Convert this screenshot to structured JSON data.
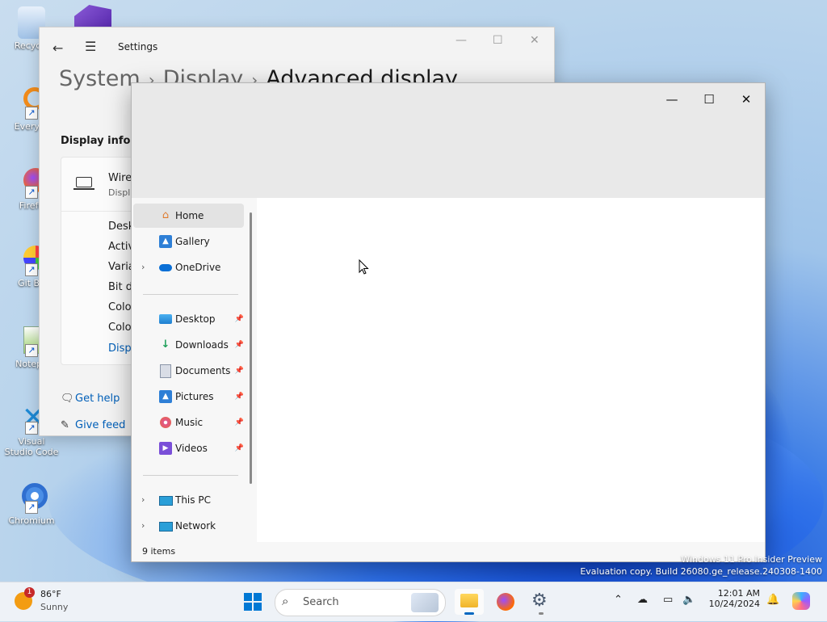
{
  "desktop": {
    "icons": [
      {
        "label": "Recycle",
        "icon": "recycle-bin-icon"
      },
      {
        "label": "Everyth",
        "icon": "everything-icon"
      },
      {
        "label": "Firefo",
        "icon": "firefox-icon"
      },
      {
        "label": "Git Ba",
        "icon": "git-bash-icon"
      },
      {
        "label": "Notepa",
        "icon": "notepad-icon"
      },
      {
        "label": "Visual Studio Code",
        "icon": "vscode-icon"
      },
      {
        "label": "Chromium",
        "icon": "chromium-icon"
      }
    ],
    "watermark": {
      "line1": "Windows 11 Pro Insider Preview",
      "line2": "Evaluation copy. Build 26080.ge_release.240308-1400"
    }
  },
  "settings": {
    "app_title": "Settings",
    "breadcrumb": [
      "System",
      "Display",
      "Advanced display"
    ],
    "section_title": "Display inform",
    "display_name": "Wire",
    "display_sub": "Displ",
    "rows": [
      "Desk",
      "Activ",
      "Varia",
      "Bit d",
      "Colo",
      "Colo"
    ],
    "link": "Disp",
    "help": [
      "Get help",
      "Give feed"
    ]
  },
  "explorer": {
    "nav": [
      {
        "label": "Home",
        "icon": "home-icon",
        "selected": true,
        "chevron": false
      },
      {
        "label": "Gallery",
        "icon": "gallery-icon",
        "selected": false,
        "chevron": false
      },
      {
        "label": "OneDrive",
        "icon": "onedrive-icon",
        "selected": false,
        "chevron": true
      }
    ],
    "quick_access": [
      {
        "label": "Desktop",
        "icon": "desktop-folder-icon"
      },
      {
        "label": "Downloads",
        "icon": "downloads-icon"
      },
      {
        "label": "Documents",
        "icon": "documents-icon"
      },
      {
        "label": "Pictures",
        "icon": "pictures-icon"
      },
      {
        "label": "Music",
        "icon": "music-icon"
      },
      {
        "label": "Videos",
        "icon": "videos-icon"
      }
    ],
    "locations": [
      {
        "label": "This PC",
        "icon": "this-pc-icon"
      },
      {
        "label": "Network",
        "icon": "network-icon"
      }
    ],
    "status": "9 items"
  },
  "taskbar": {
    "weather": {
      "temp": "86°F",
      "condition": "Sunny",
      "badge": "1"
    },
    "search_placeholder": "Search",
    "clock": {
      "time": "12:01 AM",
      "date": "10/24/2024"
    }
  }
}
